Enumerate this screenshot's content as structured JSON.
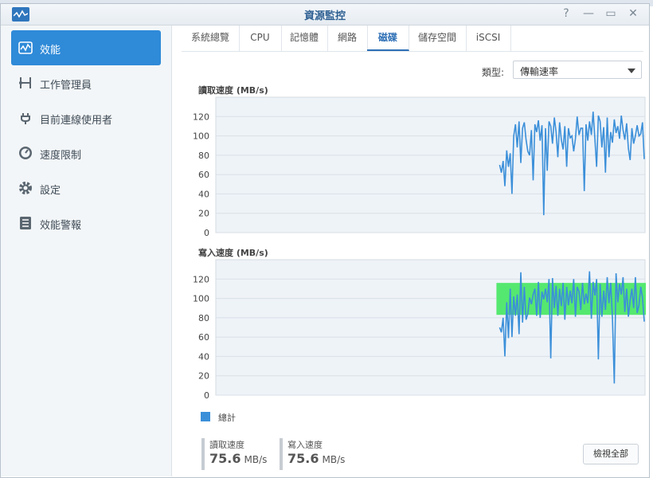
{
  "window": {
    "title": "資源監控",
    "help_label": "?",
    "minimize_label": "—",
    "maximize_label": "▭",
    "close_label": "✕"
  },
  "sidebar": {
    "items": [
      {
        "label": "效能",
        "icon": "performance-icon",
        "active": true
      },
      {
        "label": "工作管理員",
        "icon": "task-manager-icon",
        "active": false
      },
      {
        "label": "目前連線使用者",
        "icon": "plug-icon",
        "active": false
      },
      {
        "label": "速度限制",
        "icon": "speedometer-icon",
        "active": false
      },
      {
        "label": "設定",
        "icon": "gear-icon",
        "active": false
      },
      {
        "label": "效能警報",
        "icon": "report-icon",
        "active": false
      }
    ]
  },
  "tabs": [
    "系統總覽",
    "CPU",
    "記憶體",
    "網路",
    "磁碟",
    "儲存空間",
    "iSCSI"
  ],
  "active_tab": "磁碟",
  "type_filter": {
    "label": "類型:",
    "value": "傳輸速率"
  },
  "colors": {
    "accent": "#2f8ad8",
    "series": "#3b8fd9",
    "highlight": "#55e870"
  },
  "chart_data": [
    {
      "type": "line",
      "title": "讀取速度 (MB/s)",
      "ylim": [
        0,
        140
      ],
      "yticks": [
        0,
        20,
        40,
        60,
        80,
        100,
        120
      ],
      "grid": true,
      "series": [
        {
          "name": "總計",
          "values": [
            70,
            62,
            74,
            48,
            85,
            68,
            82,
            40,
            100,
            112,
            88,
            115,
            72,
            108,
            114,
            96,
            84,
            80,
            106,
            54,
            112,
            104,
            116,
            95,
            111,
            18,
            108,
            64,
            115,
            110,
            92,
            119,
            104,
            78,
            114,
            96,
            86,
            110,
            68,
            108,
            98,
            100,
            84,
            97,
            120,
            101,
            108,
            108,
            43,
            112,
            95,
            115,
            101,
            125,
            97,
            68,
            121,
            115,
            88,
            109,
            62,
            119,
            78,
            104,
            93,
            117,
            103,
            110,
            97,
            121,
            106,
            96,
            113,
            87,
            75,
            108,
            92,
            100,
            111,
            100,
            102,
            114,
            76
          ]
        }
      ]
    },
    {
      "type": "line",
      "title": "寫入速度 (MB/s)",
      "ylim": [
        0,
        140
      ],
      "yticks": [
        0,
        20,
        40,
        60,
        80,
        100,
        120
      ],
      "grid": true,
      "series": [
        {
          "name": "總計",
          "values": [
            70,
            65,
            80,
            40,
            96,
            59,
            110,
            60,
            102,
            82,
            104,
            63,
            127,
            75,
            112,
            78,
            84,
            101,
            94,
            104,
            110,
            82,
            117,
            80,
            107,
            99,
            110,
            96,
            120,
            38,
            121,
            90,
            113,
            82,
            110,
            92,
            116,
            78,
            112,
            93,
            108,
            95,
            120,
            81,
            112,
            107,
            88,
            116,
            94,
            105,
            95,
            128,
            79,
            117,
            103,
            120,
            37,
            115,
            81,
            108,
            88,
            122,
            95,
            116,
            79,
            12,
            126,
            96,
            115,
            104,
            122,
            86,
            110,
            81,
            98,
            110,
            90,
            122,
            85,
            93,
            112,
            101,
            76
          ]
        }
      ],
      "highlight_band": [
        83,
        116
      ]
    }
  ],
  "legend": {
    "label": "總計"
  },
  "stats": {
    "read": {
      "label": "讀取速度",
      "value": "75.6",
      "unit": "MB/s"
    },
    "write": {
      "label": "寫入速度",
      "value": "75.6",
      "unit": "MB/s"
    }
  },
  "view_all_label": "檢視全部"
}
